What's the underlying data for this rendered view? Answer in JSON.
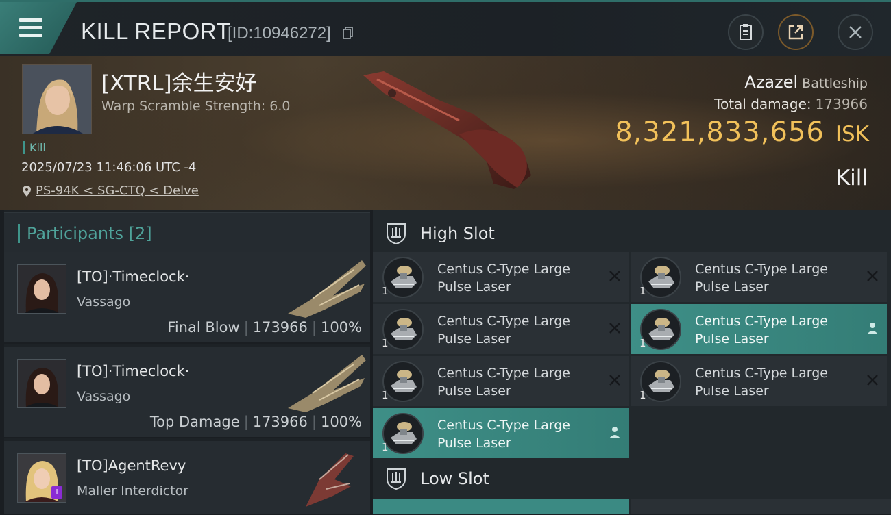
{
  "header": {
    "title": "KILL REPORT",
    "report_id": "[ID:10946272]"
  },
  "victim": {
    "name": "[XTRL]余生安好",
    "warp_scramble": "Warp Scramble Strength: 6.0",
    "kill_tag": "Kill",
    "datetime": "2025/07/23 11:46:06 UTC -4",
    "location": "PS-94K < SG-CTQ < Delve",
    "ship_name": "Azazel",
    "ship_class": "Battleship",
    "total_damage_label": "Total damage:",
    "total_damage": "173966",
    "isk_value": "8,321,833,656",
    "isk_unit": "ISK",
    "result": "Kill"
  },
  "participants": {
    "label": "Participants [2]",
    "items": [
      {
        "name": "[TO]·Timeclock·",
        "ship": "Vassago",
        "role": "Final Blow",
        "damage": "173966",
        "percent": "100%"
      },
      {
        "name": "[TO]·Timeclock·",
        "ship": "Vassago",
        "role": "Top Damage",
        "damage": "173966",
        "percent": "100%"
      },
      {
        "name": "[TO]AgentRevy",
        "ship": "Maller Interdictor",
        "role": "",
        "damage": "",
        "percent": ""
      }
    ]
  },
  "slots": {
    "high_label": "High Slot",
    "low_label": "Low Slot",
    "high_items": [
      {
        "name_line1": "Centus C-Type Large",
        "name_line2": "Pulse Laser",
        "qty": "1",
        "status": "destroyed"
      },
      {
        "name_line1": "Centus C-Type Large",
        "name_line2": "Pulse Laser",
        "qty": "1",
        "status": "destroyed"
      },
      {
        "name_line1": "Centus C-Type Large",
        "name_line2": "Pulse Laser",
        "qty": "1",
        "status": "destroyed"
      },
      {
        "name_line1": "Centus C-Type Large",
        "name_line2": "Pulse Laser",
        "qty": "1",
        "status": "dropped"
      },
      {
        "name_line1": "Centus C-Type Large",
        "name_line2": "Pulse Laser",
        "qty": "1",
        "status": "destroyed"
      },
      {
        "name_line1": "Centus C-Type Large",
        "name_line2": "Pulse Laser",
        "qty": "1",
        "status": "destroyed"
      },
      {
        "name_line1": "Centus C-Type Large",
        "name_line2": "Pulse Laser",
        "qty": "1",
        "status": "dropped"
      }
    ]
  },
  "colors": {
    "accent_teal": "#3f958b",
    "isk_gold": "#f2c15a",
    "highlight_row": "#3e8f87"
  },
  "icons": [
    "menu-icon",
    "copy-icon",
    "clipboard-icon",
    "share-icon",
    "close-icon",
    "location-pin-icon",
    "shield-slot-icon",
    "destroyed-x-icon",
    "dropped-person-icon"
  ]
}
